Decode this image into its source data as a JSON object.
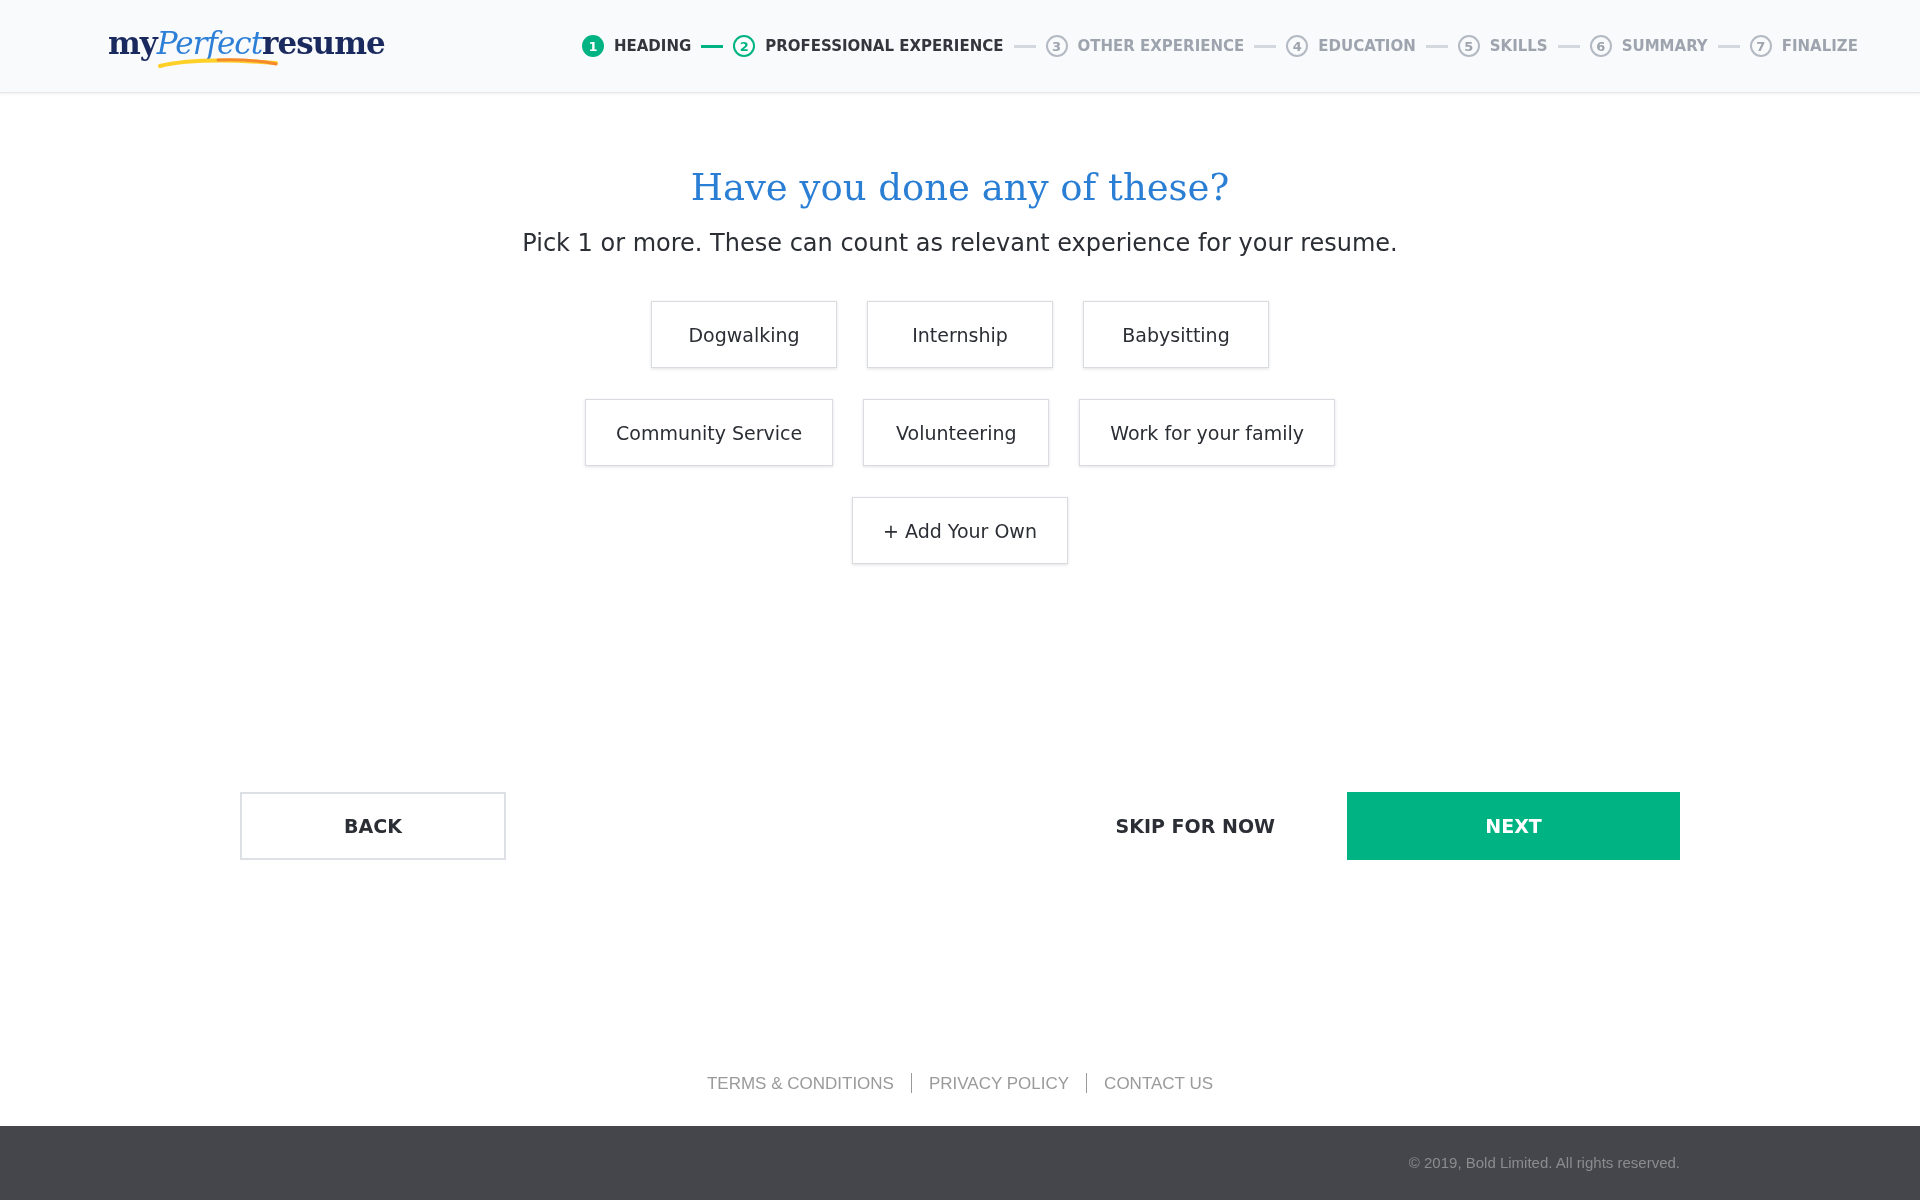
{
  "logo": {
    "parts": [
      "my",
      "Perfect",
      "resume"
    ]
  },
  "steps": [
    {
      "number": "1",
      "label": "HEADING",
      "completed": true,
      "selected": false
    },
    {
      "number": "2",
      "label": "PROFESSIONAL EXPERIENCE",
      "completed": false,
      "selected": true
    },
    {
      "number": "3",
      "label": "OTHER EXPERIENCE",
      "completed": false,
      "selected": false
    },
    {
      "number": "4",
      "label": "EDUCATION",
      "completed": false,
      "selected": false
    },
    {
      "number": "5",
      "label": "SKILLS",
      "completed": false,
      "selected": false
    },
    {
      "number": "6",
      "label": "SUMMARY",
      "completed": false,
      "selected": false
    },
    {
      "number": "7",
      "label": "FINALIZE",
      "completed": false,
      "selected": false
    }
  ],
  "heading": "Have you done any of these?",
  "subheading": "Pick 1 or more. These can count as relevant experience for your resume.",
  "options": [
    [
      "Dogwalking",
      "Internship",
      "Babysitting"
    ],
    [
      "Community Service",
      "Volunteering",
      "Work for your family"
    ],
    [
      "+ Add Your Own"
    ]
  ],
  "actions": {
    "back": "BACK",
    "skip": "SKIP FOR NOW",
    "next": "NEXT"
  },
  "footer_links": [
    "TERMS & CONDITIONS",
    "PRIVACY POLICY",
    "CONTACT US"
  ],
  "copyright": "© 2019, Bold Limited. All rights reserved."
}
